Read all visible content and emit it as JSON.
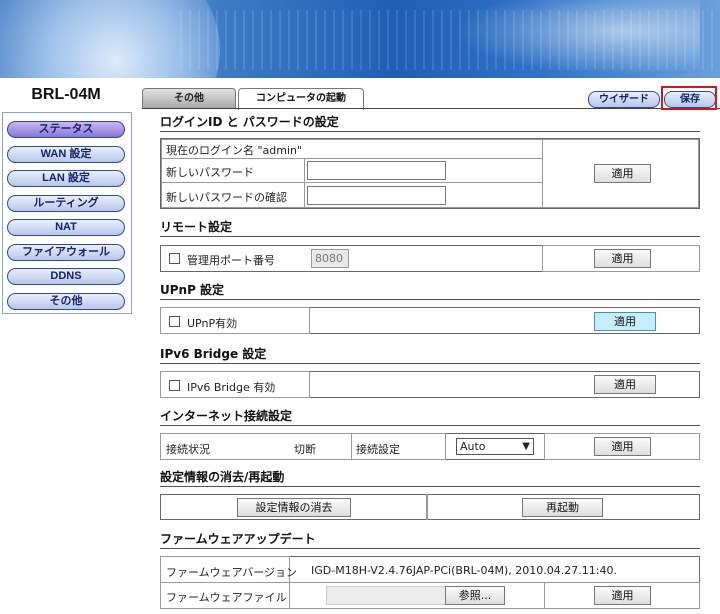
{
  "sidebar": {
    "model": "BRL-04M",
    "items": [
      {
        "label": "ステータス"
      },
      {
        "label": "WAN 設定"
      },
      {
        "label": "LAN 設定"
      },
      {
        "label": "ルーティング"
      },
      {
        "label": "NAT"
      },
      {
        "label": "ファイアウォール"
      },
      {
        "label": "DDNS"
      },
      {
        "label": "その他"
      }
    ]
  },
  "tabs": [
    {
      "label": "その他"
    },
    {
      "label": "コンピュータの起動"
    }
  ],
  "toolbar": {
    "wizard_label": "ウイザード",
    "save_label": "保存"
  },
  "login": {
    "title": "ログインID と パスワードの設定",
    "current_user": "現在のログイン名 \"admin\"",
    "new_password_label": "新しいパスワード",
    "confirm_password_label": "新しいパスワードの確認",
    "new_password_value": "",
    "confirm_password_value": "",
    "apply": "適用"
  },
  "remote": {
    "title": "リモート設定",
    "port_label": "管理用ポート番号",
    "port_value": "8080",
    "apply": "適用"
  },
  "upnp": {
    "title": "UPnP 設定",
    "enable_label": "UPnP有効",
    "apply": "適用"
  },
  "ipv6": {
    "title": "IPv6 Bridge 設定",
    "enable_label": "IPv6 Bridge 有効",
    "apply": "適用"
  },
  "internet": {
    "title": "インターネット接続設定",
    "status_label": "接続状況",
    "status_value": "切断",
    "mode_label": "接続設定",
    "mode_value": "Auto",
    "apply": "適用"
  },
  "reset": {
    "title": "設定情報の消去/再起動",
    "clear_label": "設定情報の消去",
    "reboot_label": "再起動"
  },
  "firmware": {
    "title": "ファームウェアアップデート",
    "version_label": "ファームウェアバージョン",
    "version_value": "IGD-M18H-V2.4.76JAP-PCi(BRL-04M), 2010.04.27.11:40.",
    "file_label": "ファームウェアファイル",
    "browse_label": "参照...",
    "apply": "適用"
  }
}
